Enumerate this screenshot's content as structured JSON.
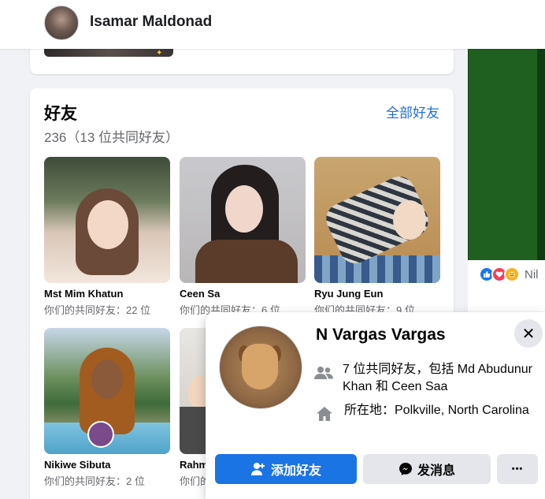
{
  "header": {
    "profile_name": "Isamar Maldonad"
  },
  "friends": {
    "title": "好友",
    "subtitle": "236（13 位共同好友）",
    "see_all": "全部好友",
    "items": [
      {
        "name": "Mst Mim Khatun",
        "mutual": "你们的共同好友：22 位"
      },
      {
        "name": "Ceen Sa",
        "mutual": "你们的共同好友：6 位"
      },
      {
        "name": "Ryu Jung Eun",
        "mutual": "你们的共同好友：9 位"
      },
      {
        "name": "Nikiwe Sibuta",
        "mutual": "你们的共同好友：2 位"
      },
      {
        "name": "Rahm",
        "mutual": "你们的"
      }
    ]
  },
  "side": {
    "reaction_name": "Nil"
  },
  "hover_card": {
    "name": "N Vargas Vargas",
    "mutual_text": "7 位共同好友，包括 Md Abudunur Khan 和 Ceen Saa",
    "location_text": "所在地：Polkville, North Carolina",
    "add_friend": "添加好友",
    "message": "发消息",
    "more": "•••",
    "close": "✕"
  },
  "colors": {
    "accent": "#1b74e4",
    "link": "#216fdb",
    "background": "#f0f2f5"
  },
  "icons": [
    "people-icon",
    "home-icon",
    "add-friend-icon",
    "messenger-icon",
    "close-icon",
    "like-reaction-icon",
    "love-reaction-icon",
    "care-reaction-icon"
  ]
}
